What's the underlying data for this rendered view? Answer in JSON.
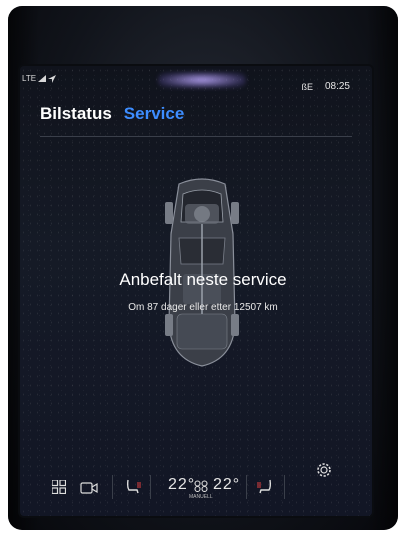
{
  "status_bar": {
    "network_label": "LTE",
    "bluetooth_label": "ßE",
    "time": "08:25"
  },
  "tabs": [
    {
      "label": "Bilstatus",
      "selected": false
    },
    {
      "label": "Service",
      "selected": true
    }
  ],
  "service_message": {
    "title": "Anbefalt neste service",
    "detail": "Om 87 dager eller etter 12507 km"
  },
  "bottom_bar": {
    "left_temp": "22°",
    "right_temp": "22°",
    "climate_mode": "MANUELL",
    "icons": [
      "apps-grid-icon",
      "camera-icon",
      "heated-seat-left-icon",
      "fan-icon",
      "heated-seat-right-icon",
      "settings-icon"
    ]
  },
  "colors": {
    "selected_tab": "#3d8dff",
    "text": "#ffffff",
    "background": "#121625"
  }
}
